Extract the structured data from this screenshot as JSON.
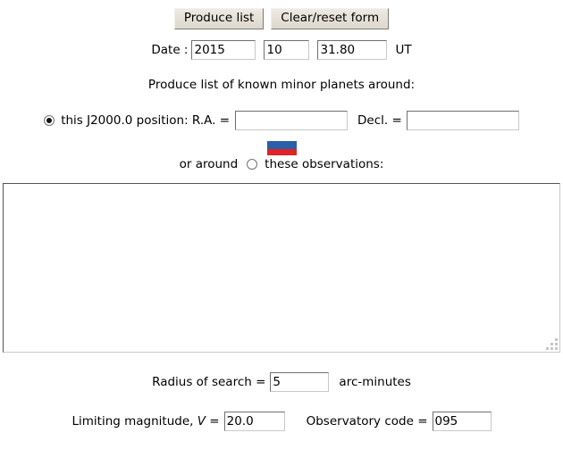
{
  "toolbar": {
    "produce_label": "Produce list",
    "clear_label": "Clear/reset form"
  },
  "date": {
    "label": "Date :",
    "year": "2015",
    "month": "10",
    "day": "31.80",
    "suffix": "UT"
  },
  "headline": "Produce list of known minor planets around:",
  "position": {
    "option_label": "this J2000.0 position: R.A. =",
    "selected": true,
    "ra_value": "",
    "ra_placeholder": "",
    "decl_label": "Decl. =",
    "decl_value": "",
    "decl_placeholder": ""
  },
  "observations": {
    "prefix": "or around",
    "option_label": "these observations:",
    "selected": false,
    "textarea_value": "",
    "textarea_placeholder": "",
    "flag_name": "russia-flag-icon",
    "flag_colors": {
      "white": "#ffffff",
      "blue": "#2a60a8",
      "red": "#e02326"
    }
  },
  "radius": {
    "label": "Radius of search =",
    "value": "5",
    "unit": "arc-minutes"
  },
  "magnitude": {
    "label_prefix": "Limiting magnitude,",
    "label_symbol": "V",
    "label_eq": "=",
    "value": "20.0"
  },
  "observatory": {
    "label": "Observatory code =",
    "value": "095"
  }
}
